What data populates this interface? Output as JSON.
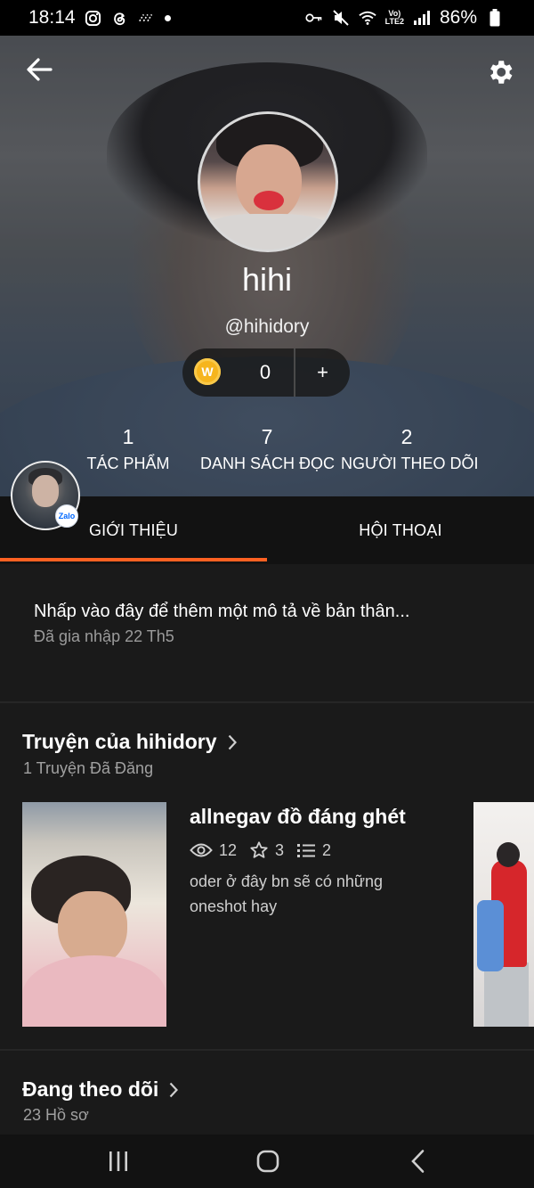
{
  "status_bar": {
    "time": "18:14",
    "left_icons": [
      "instagram-icon",
      "threads-icon",
      "activity-icon",
      "dot-icon"
    ],
    "right_icons": [
      "key-icon",
      "mute-icon",
      "wifi-icon",
      "volte-icon",
      "signal-icon"
    ],
    "volte_label": "Vo)",
    "lte_label": "LTE2",
    "battery": "86%"
  },
  "header": {
    "back_icon": "arrow-left-icon",
    "settings_icon": "gear-icon"
  },
  "profile": {
    "display_name": "hihi",
    "username": "@hihidory",
    "coins": "0",
    "coin_symbol": "W",
    "add_label": "+"
  },
  "stats": [
    {
      "value": "1",
      "label": "TÁC PHẨM"
    },
    {
      "value": "7",
      "label": "DANH SÁCH ĐỌC"
    },
    {
      "value": "2",
      "label": "NGƯỜI THEO DÕI"
    }
  ],
  "overlay_avatar": {
    "badge": "Zalo"
  },
  "tabs": {
    "items": [
      {
        "label": "GIỚI THIỆU",
        "active": true
      },
      {
        "label": "HỘI THOẠI",
        "active": false
      }
    ],
    "accent_color": "#ff6122"
  },
  "about": {
    "description": "Nhấp vào đây để thêm một mô tả về bản thân...",
    "joined": "Đã gia nhập 22 Th5"
  },
  "stories_section": {
    "title": "Truyện của hihidory",
    "subtitle": "1 Truyện Đã Đăng",
    "stories": [
      {
        "title": "allnegav đồ đáng ghét",
        "reads": "12",
        "votes": "3",
        "parts": "2",
        "description": "oder ở đây bn sẽ có những oneshot hay"
      }
    ]
  },
  "following_section": {
    "title": "Đang theo dõi",
    "subtitle": "23 Hồ sơ"
  },
  "nav_bar": {
    "icons": [
      "recent-apps-icon",
      "home-icon",
      "back-nav-icon"
    ]
  }
}
